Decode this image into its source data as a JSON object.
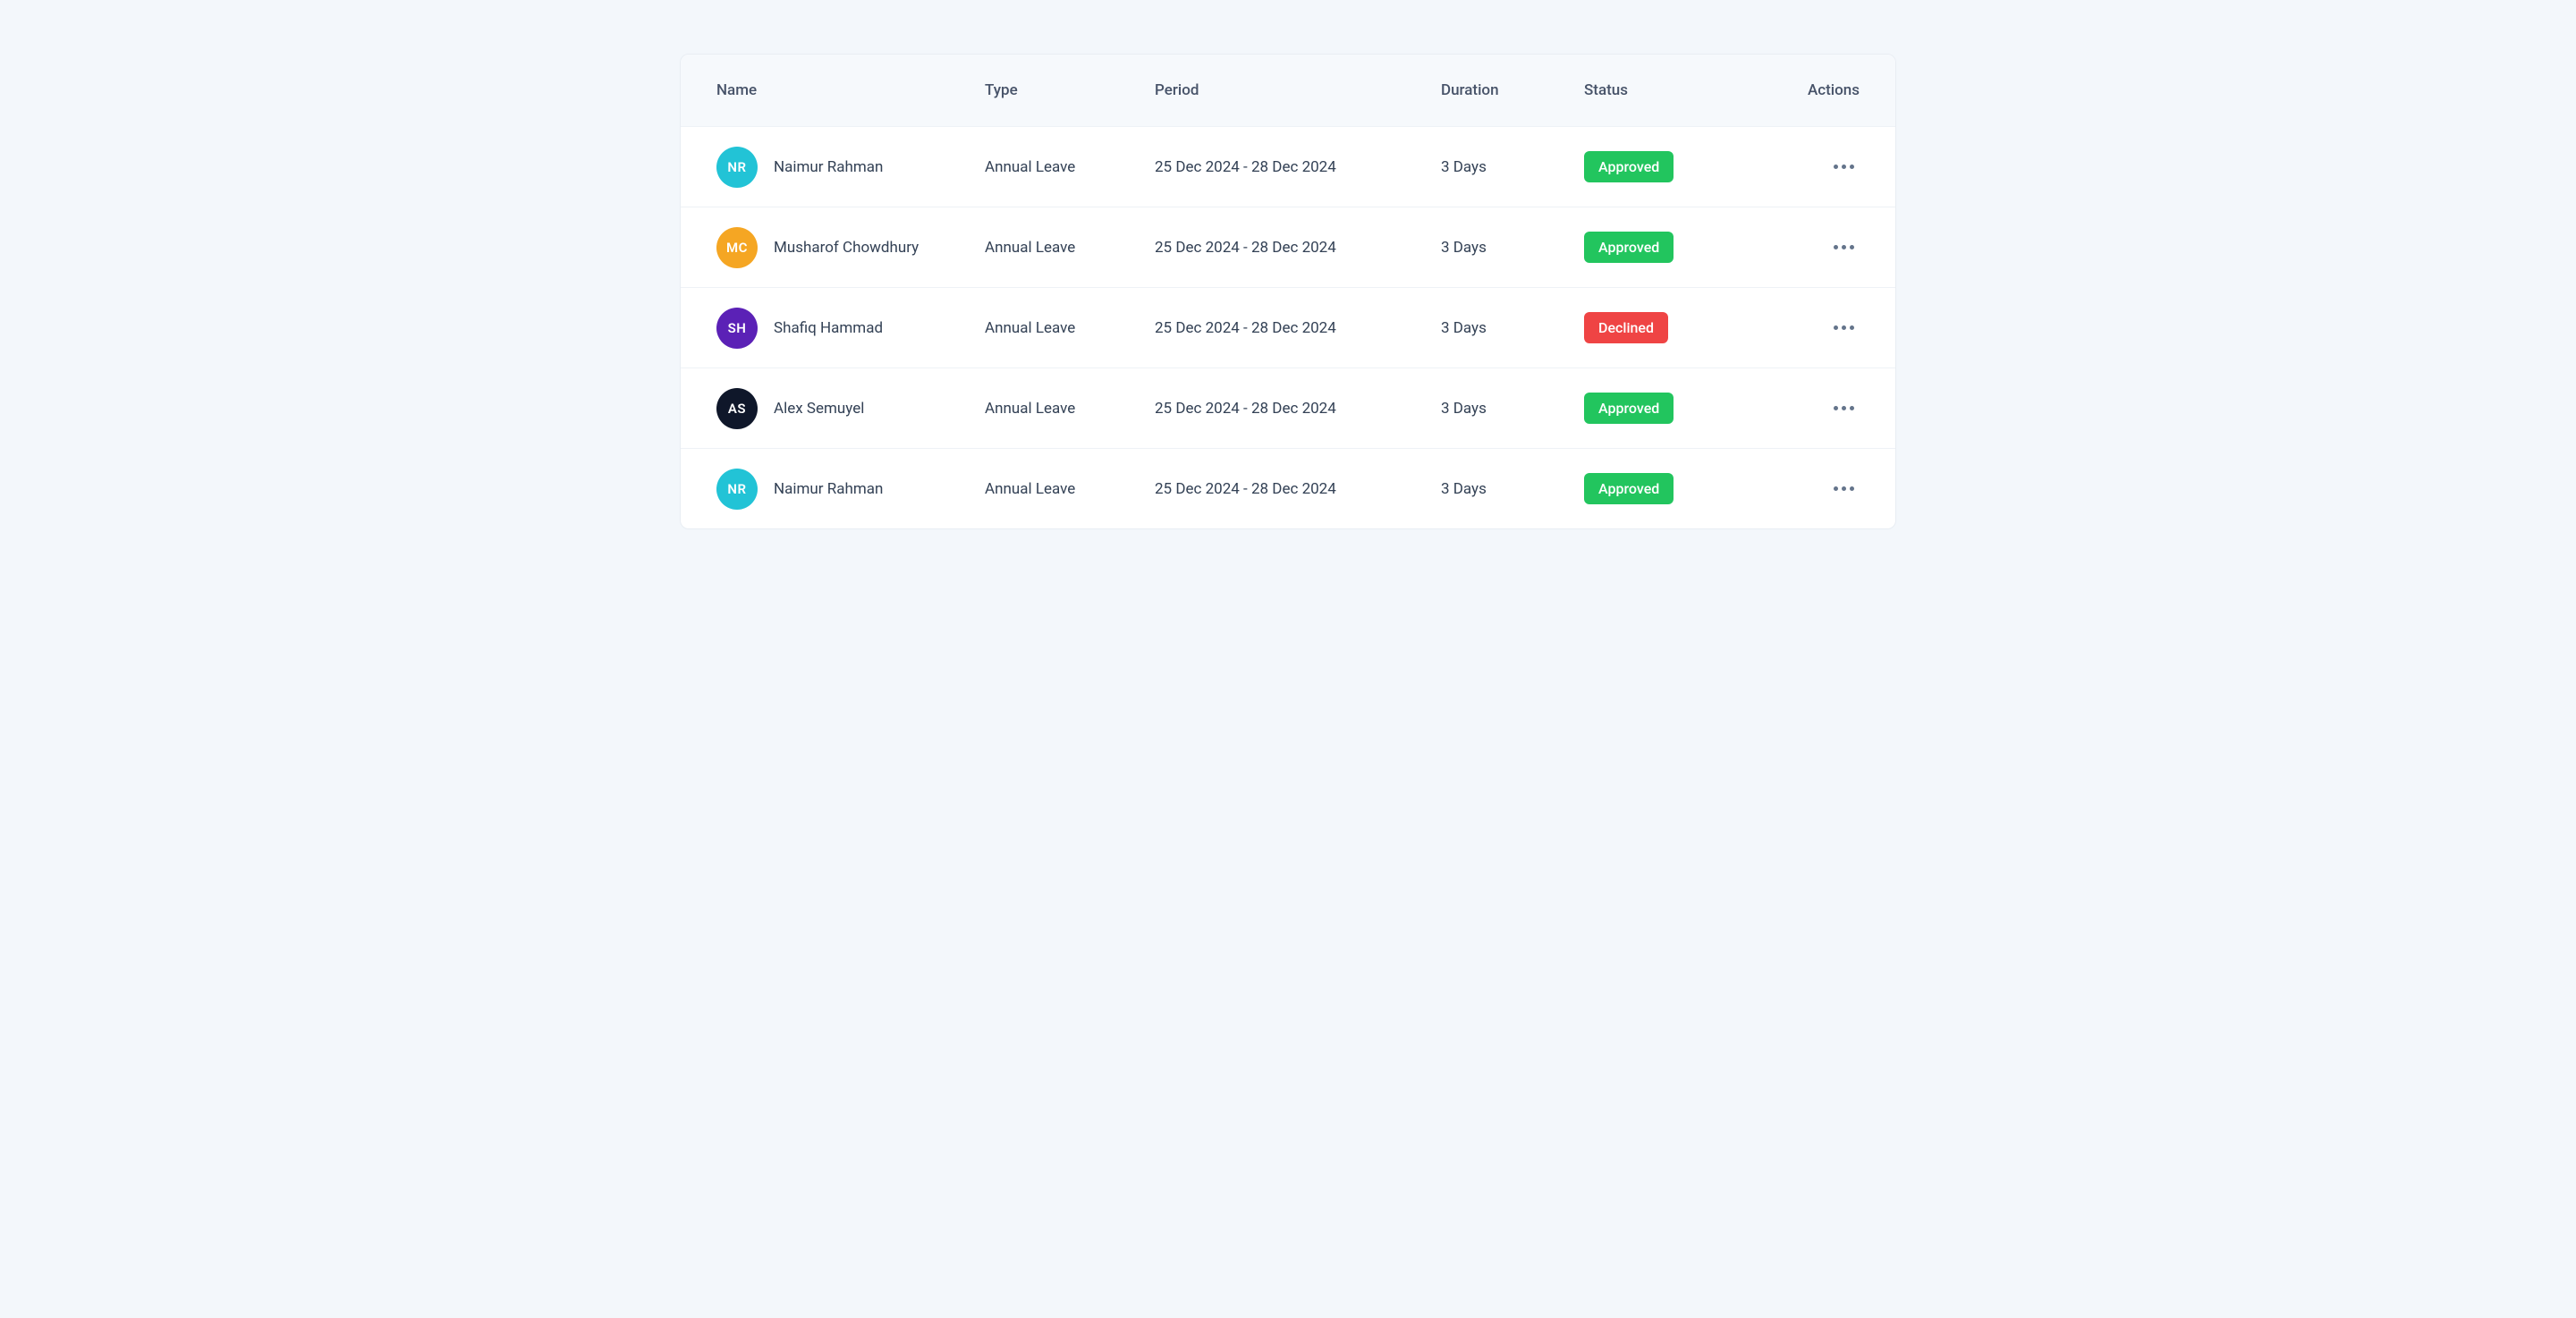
{
  "columns": {
    "name": "Name",
    "type": "Type",
    "period": "Period",
    "duration": "Duration",
    "status": "Status",
    "actions": "Actions"
  },
  "status_colors": {
    "Approved": "#22c55e",
    "Declined": "#ef4444"
  },
  "rows": [
    {
      "initials": "NR",
      "avatar_color": "#22c3d6",
      "name": "Naimur Rahman",
      "type": "Annual Leave",
      "period": "25 Dec 2024 - 28 Dec 2024",
      "duration": "3 Days",
      "status": "Approved"
    },
    {
      "initials": "MC",
      "avatar_color": "#f5a623",
      "name": "Musharof Chowdhury",
      "type": "Annual Leave",
      "period": "25 Dec 2024 - 28 Dec 2024",
      "duration": "3 Days",
      "status": "Approved"
    },
    {
      "initials": "SH",
      "avatar_color": "#5b21b6",
      "name": "Shafiq Hammad",
      "type": "Annual Leave",
      "period": "25 Dec 2024 - 28 Dec 2024",
      "duration": "3 Days",
      "status": "Declined"
    },
    {
      "initials": "AS",
      "avatar_color": "#0f172a",
      "name": "Alex Semuyel",
      "type": "Annual Leave",
      "period": "25 Dec 2024 - 28 Dec 2024",
      "duration": "3 Days",
      "status": "Approved"
    },
    {
      "initials": "NR",
      "avatar_color": "#22c3d6",
      "name": "Naimur Rahman",
      "type": "Annual Leave",
      "period": "25 Dec 2024 - 28 Dec 2024",
      "duration": "3 Days",
      "status": "Approved"
    }
  ]
}
